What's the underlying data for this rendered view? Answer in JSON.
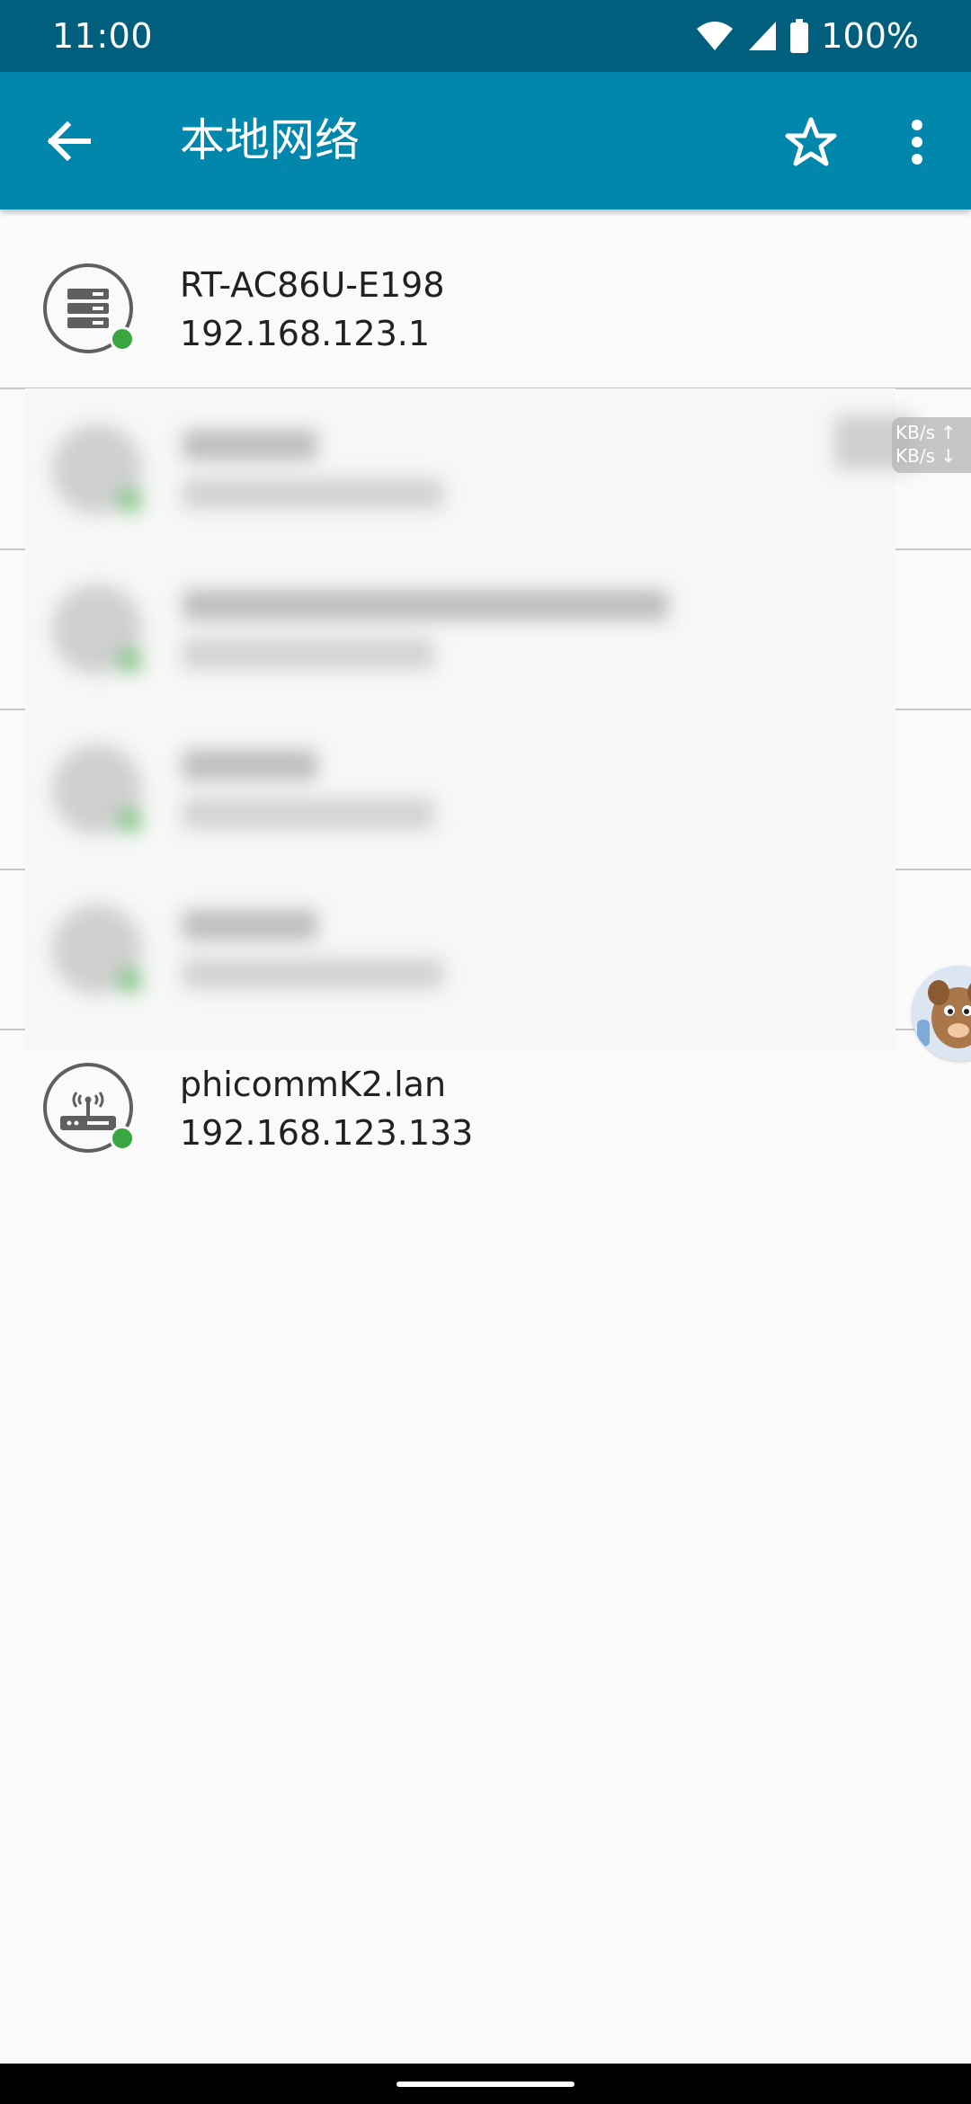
{
  "status_bar": {
    "time": "11:00",
    "battery": "100%"
  },
  "app_bar": {
    "title": "本地网络"
  },
  "devices": [
    {
      "name": "RT-AC86U-E198",
      "ip": "192.168.123.1",
      "icon": "server-icon",
      "online": true
    },
    {
      "name": "phicommK2.lan",
      "ip": "192.168.123.133",
      "icon": "router-antenna-icon",
      "online": true
    }
  ],
  "speed_overlay": {
    "up": "KB/s ↑",
    "down": "KB/s ↓"
  },
  "colors": {
    "status_bar": "#015f7e",
    "app_bar": "#0186ac",
    "online": "#3aa63f"
  }
}
